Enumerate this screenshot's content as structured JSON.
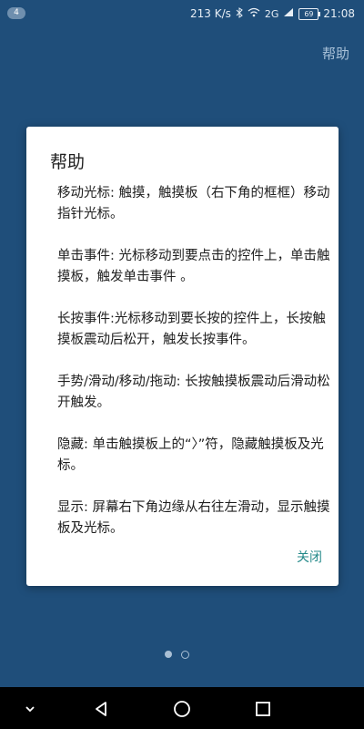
{
  "status": {
    "notification_count": "4",
    "speed": "213 K/s",
    "network": "2G",
    "battery": "69",
    "time": "21:08"
  },
  "header": {
    "help_label": "帮助"
  },
  "dialog": {
    "title": "帮助",
    "body": "移动光标: 触摸，触摸板（右下角的框框）移动指针光标。\n\n单击事件: 光标移动到要点击的控件上，单击触摸板，触发单击事件 。\n\n长按事件:光标移动到要长按的控件上，长按触摸板震动后松开，触发长按事件。\n\n手势/滑动/移动/拖动: 长按触摸板震动后滑动松开触发。\n\n隐藏: 单击触摸板上的“〉”符，隐藏触摸板及光标。\n\n显示: 屏幕右下角边缘从右往左滑动，显示触摸板及光标。",
    "close_label": "关闭"
  },
  "pager": {
    "current_page": 1,
    "total_pages": 2
  },
  "colors": {
    "background": "#1f4e7a",
    "accent": "#258a8a"
  }
}
